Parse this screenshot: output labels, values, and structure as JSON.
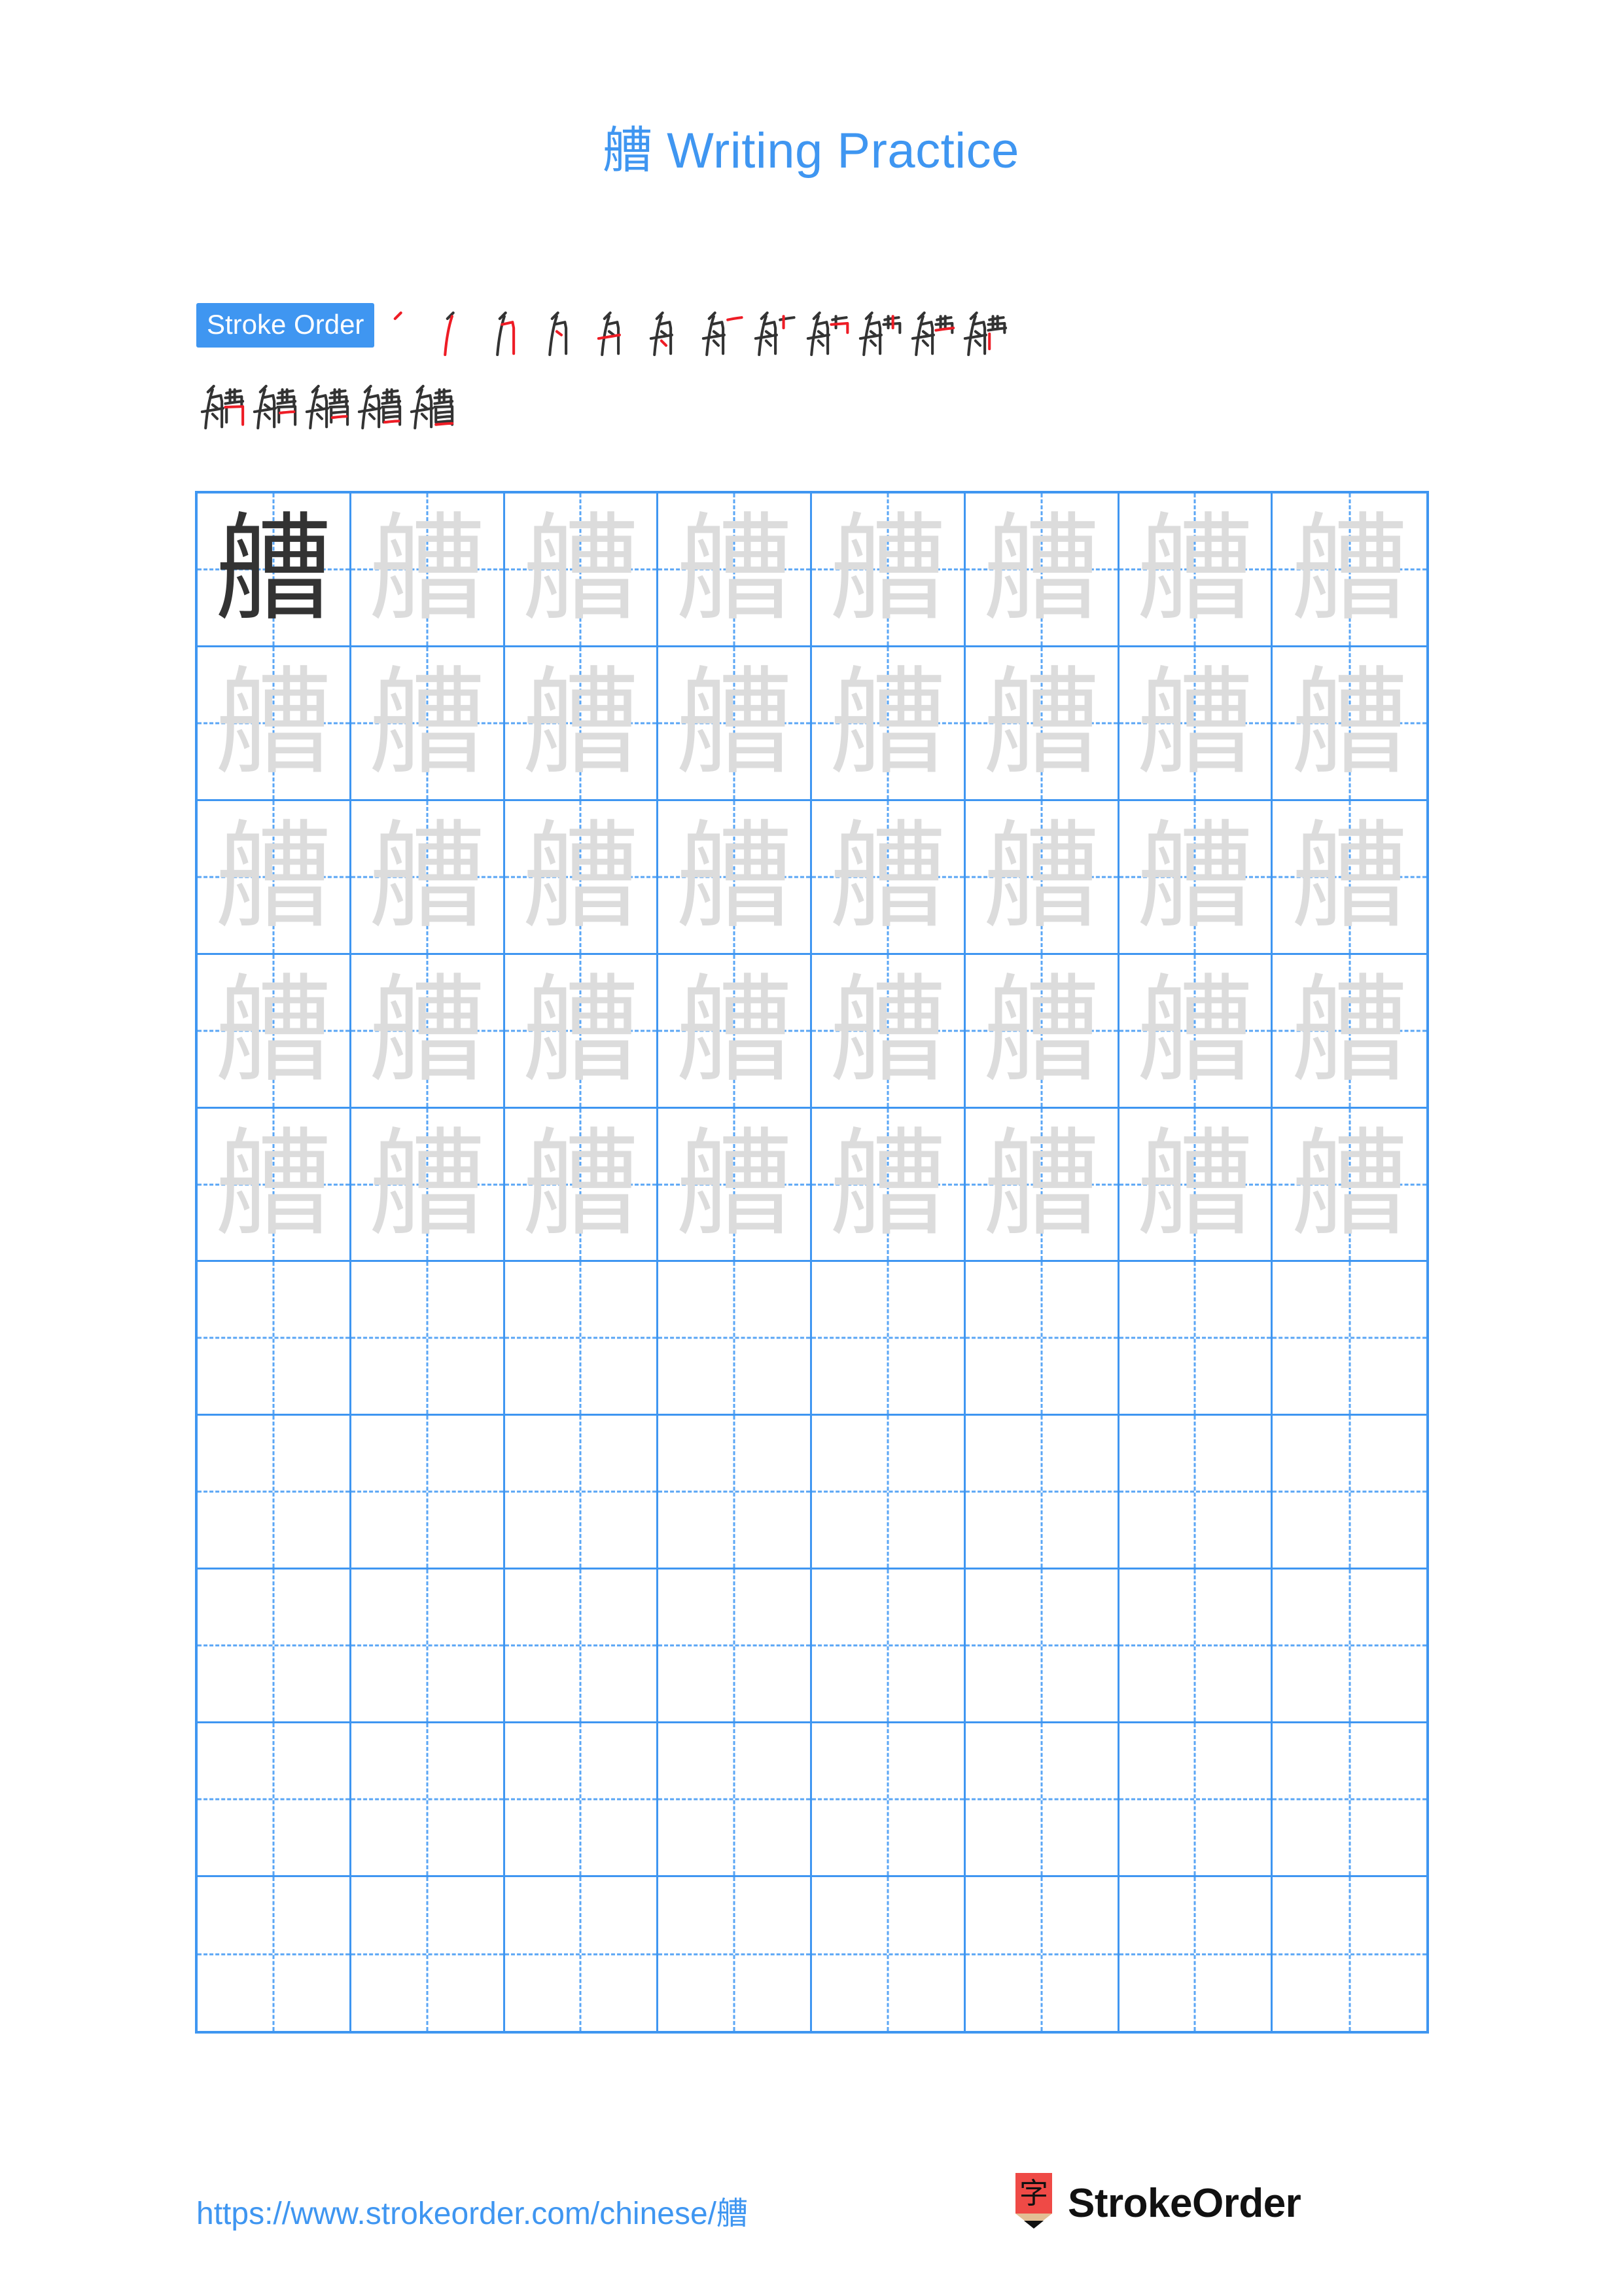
{
  "page": {
    "character": "艚",
    "background_color": "#ffffff",
    "accent_color": "#3f96f1",
    "trace_color": "#dcdcdc",
    "ink_color": "#333333",
    "highlight_stroke_color": "#ee1c25"
  },
  "title": {
    "character": "艚",
    "text": " Writing Practice",
    "full": "艚 Writing Practice",
    "color": "#3f96f1"
  },
  "stroke_order": {
    "badge_label": "Stroke Order",
    "badge_bg": "#3f96f1",
    "badge_color": "#ffffff",
    "total_strokes": 17,
    "steps": [
      {
        "index": 1,
        "strokes_drawn": 1,
        "new_stroke_color": "#ee1c25"
      },
      {
        "index": 2,
        "strokes_drawn": 2,
        "new_stroke_color": "#ee1c25"
      },
      {
        "index": 3,
        "strokes_drawn": 3,
        "new_stroke_color": "#ee1c25"
      },
      {
        "index": 4,
        "strokes_drawn": 4,
        "new_stroke_color": "#ee1c25"
      },
      {
        "index": 5,
        "strokes_drawn": 5,
        "new_stroke_color": "#ee1c25"
      },
      {
        "index": 6,
        "strokes_drawn": 6,
        "new_stroke_color": "#ee1c25"
      },
      {
        "index": 7,
        "strokes_drawn": 7,
        "new_stroke_color": "#ee1c25"
      },
      {
        "index": 8,
        "strokes_drawn": 8,
        "new_stroke_color": "#ee1c25"
      },
      {
        "index": 9,
        "strokes_drawn": 9,
        "new_stroke_color": "#ee1c25"
      },
      {
        "index": 10,
        "strokes_drawn": 10,
        "new_stroke_color": "#ee1c25"
      },
      {
        "index": 11,
        "strokes_drawn": 11,
        "new_stroke_color": "#ee1c25"
      },
      {
        "index": 12,
        "strokes_drawn": 12,
        "new_stroke_color": "#ee1c25"
      },
      {
        "index": 13,
        "strokes_drawn": 13,
        "new_stroke_color": "#ee1c25"
      },
      {
        "index": 14,
        "strokes_drawn": 14,
        "new_stroke_color": "#ee1c25"
      },
      {
        "index": 15,
        "strokes_drawn": 15,
        "new_stroke_color": "#ee1c25"
      },
      {
        "index": 16,
        "strokes_drawn": 16,
        "new_stroke_color": "#ee1c25"
      },
      {
        "index": 17,
        "strokes_drawn": 17,
        "new_stroke_color": "#ee1c25"
      }
    ],
    "steps_row_1_count": 12,
    "steps_row_2_count": 5
  },
  "practice_grid": {
    "rows": 10,
    "columns": 8,
    "filled_rows": 5,
    "empty_rows": 5,
    "border_color": "#3f96f1",
    "guide_color": "#5aa6f5",
    "cells": [
      [
        "艚",
        "艚",
        "艚",
        "艚",
        "艚",
        "艚",
        "艚",
        "艚"
      ],
      [
        "艚",
        "艚",
        "艚",
        "艚",
        "艚",
        "艚",
        "艚",
        "艚"
      ],
      [
        "艚",
        "艚",
        "艚",
        "艚",
        "艚",
        "艚",
        "艚",
        "艚"
      ],
      [
        "艚",
        "艚",
        "艚",
        "艚",
        "艚",
        "艚",
        "艚",
        "艚"
      ],
      [
        "艚",
        "艚",
        "艚",
        "艚",
        "艚",
        "艚",
        "艚",
        "艚"
      ],
      [
        "",
        "",
        "",
        "",
        "",
        "",
        "",
        ""
      ],
      [
        "",
        "",
        "",
        "",
        "",
        "",
        "",
        ""
      ],
      [
        "",
        "",
        "",
        "",
        "",
        "",
        "",
        ""
      ],
      [
        "",
        "",
        "",
        "",
        "",
        "",
        "",
        ""
      ],
      [
        "",
        "",
        "",
        "",
        "",
        "",
        "",
        ""
      ]
    ],
    "cell_styles": [
      [
        "dark",
        "trace",
        "trace",
        "trace",
        "trace",
        "trace",
        "trace",
        "trace"
      ],
      [
        "trace",
        "trace",
        "trace",
        "trace",
        "trace",
        "trace",
        "trace",
        "trace"
      ],
      [
        "trace",
        "trace",
        "trace",
        "trace",
        "trace",
        "trace",
        "trace",
        "trace"
      ],
      [
        "trace",
        "trace",
        "trace",
        "trace",
        "trace",
        "trace",
        "trace",
        "trace"
      ],
      [
        "trace",
        "trace",
        "trace",
        "trace",
        "trace",
        "trace",
        "trace",
        "trace"
      ],
      [
        "empty",
        "empty",
        "empty",
        "empty",
        "empty",
        "empty",
        "empty",
        "empty"
      ],
      [
        "empty",
        "empty",
        "empty",
        "empty",
        "empty",
        "empty",
        "empty",
        "empty"
      ],
      [
        "empty",
        "empty",
        "empty",
        "empty",
        "empty",
        "empty",
        "empty",
        "empty"
      ],
      [
        "empty",
        "empty",
        "empty",
        "empty",
        "empty",
        "empty",
        "empty",
        "empty"
      ],
      [
        "empty",
        "empty",
        "empty",
        "empty",
        "empty",
        "empty",
        "empty",
        "empty"
      ]
    ]
  },
  "footer": {
    "url": "https://www.strokeorder.com/chinese/艚",
    "url_color": "#3f96f1",
    "logo_text": "StrokeOrder",
    "logo_icon_character": "字",
    "logo_body_color": "#ef4a46",
    "logo_wood_color": "#e3bf94",
    "logo_tip_color": "#111111"
  }
}
